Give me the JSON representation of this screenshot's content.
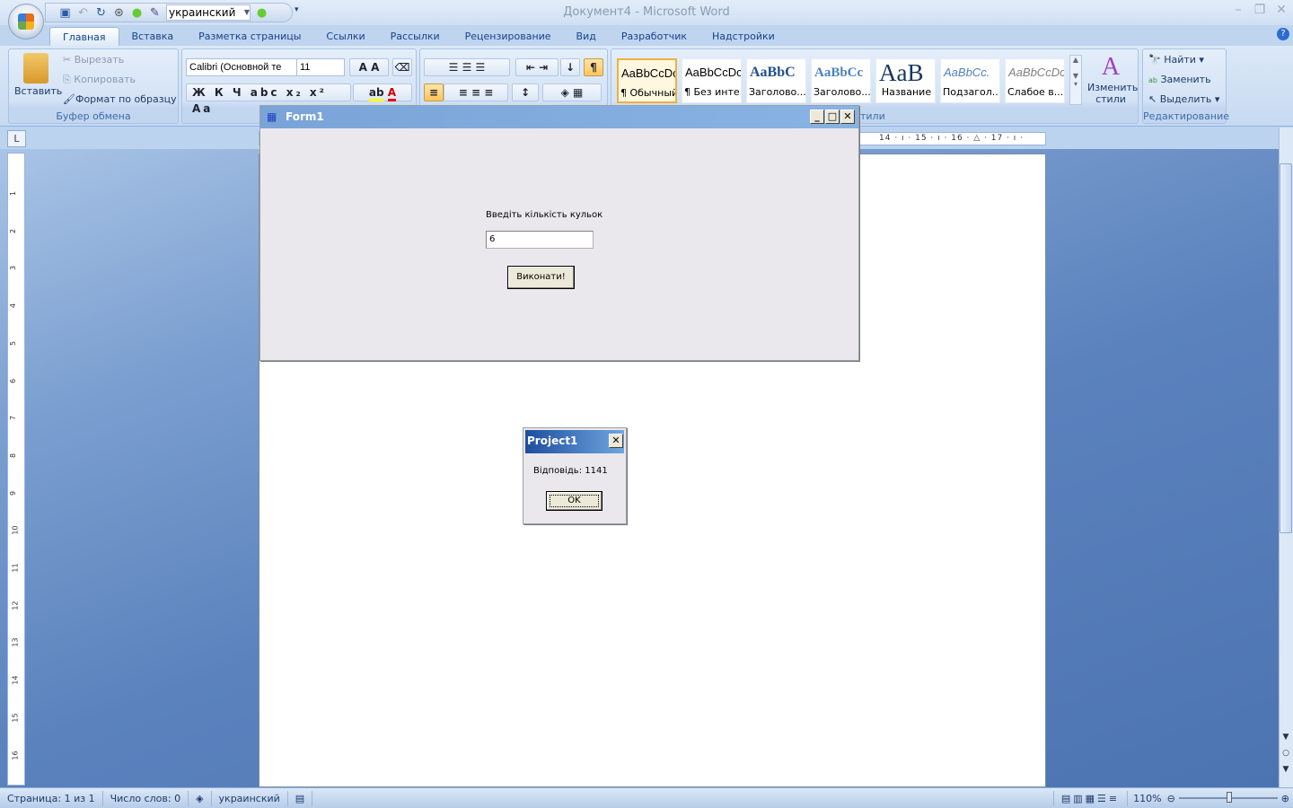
{
  "app": {
    "title": "Документ4 - Microsoft Word"
  },
  "qat": {
    "language": "украинский"
  },
  "tabs": [
    "Главная",
    "Вставка",
    "Разметка страницы",
    "Ссылки",
    "Рассылки",
    "Рецензирование",
    "Вид",
    "Разработчик",
    "Надстройки"
  ],
  "clipboard": {
    "paste": "Вставить",
    "cut": "Вырезать",
    "copy": "Копировать",
    "format_painter": "Формат по образцу",
    "label": "Буфер обмена"
  },
  "font": {
    "name": "Calibri (Основной те",
    "size": "11"
  },
  "styles": {
    "items": [
      {
        "preview": "AaBbCcDc",
        "name": "¶ Обычный"
      },
      {
        "preview": "AaBbCcDc",
        "name": "¶ Без инте..."
      },
      {
        "preview": "AaBbC",
        "name": "Заголово..."
      },
      {
        "preview": "AaBbCc",
        "name": "Заголово..."
      },
      {
        "preview": "AaB",
        "name": "Название"
      },
      {
        "preview": "AaBbCc.",
        "name": "Подзагол..."
      },
      {
        "preview": "AaBbCcDc",
        "name": "Слабое в..."
      }
    ],
    "change": "Изменить стили",
    "label_partial": "тили"
  },
  "editing": {
    "find": "Найти",
    "replace": "Заменить",
    "select": "Выделить",
    "label": "Редактирование"
  },
  "ruler": {
    "ticks": "14 · ı · 15 · ı · 16 · △ · 17 · ı ·"
  },
  "vruler_ticks": [
    "1",
    "2",
    "3",
    "4",
    "5",
    "6",
    "7",
    "8",
    "9",
    "10",
    "11",
    "12",
    "13",
    "14",
    "15",
    "16"
  ],
  "form1": {
    "title": "Form1",
    "prompt": "Введіть кількість кульок",
    "input_value": "6",
    "button": "Виконати!"
  },
  "dialog": {
    "title": "Project1",
    "message": "Відповідь: 1141",
    "ok": "OK"
  },
  "status": {
    "page": "Страница: 1 из 1",
    "words": "Число слов: 0",
    "language": "украинский",
    "zoom": "110%"
  },
  "zoom_level_percent": 110
}
